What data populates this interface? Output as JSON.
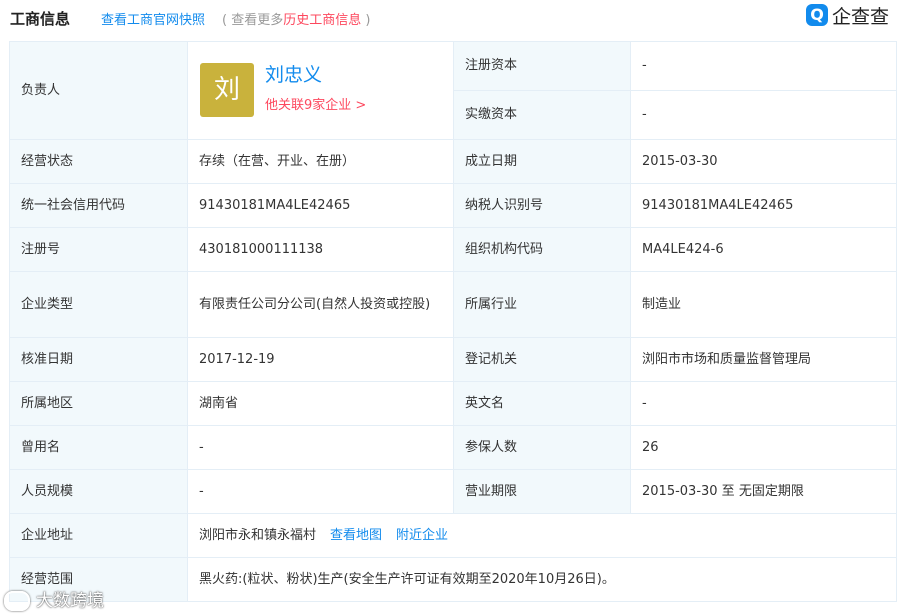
{
  "header": {
    "title": "工商信息",
    "snapshot_link": "查看工商官网快照",
    "more_prefix": "( 查看更多",
    "more_link": "历史工商信息",
    "more_suffix": " )",
    "logo_mark": "Q",
    "logo_text": "企查查"
  },
  "person": {
    "label": "负责人",
    "avatar_char": "刘",
    "name": "刘忠义",
    "related": "他关联9家企业 >"
  },
  "rows": {
    "reg_capital_label": "注册资本",
    "reg_capital_value": "-",
    "paid_capital_label": "实缴资本",
    "paid_capital_value": "-",
    "status_label": "经营状态",
    "status_value": "存续（在营、开业、在册）",
    "founded_label": "成立日期",
    "founded_value": "2015-03-30",
    "credit_code_label": "统一社会信用代码",
    "credit_code_value": "91430181MA4LE42465",
    "taxpayer_label": "纳税人识别号",
    "taxpayer_value": "91430181MA4LE42465",
    "reg_no_label": "注册号",
    "reg_no_value": "430181000111138",
    "org_code_label": "组织机构代码",
    "org_code_value": "MA4LE424-6",
    "type_label": "企业类型",
    "type_value": "有限责任公司分公司(自然人投资或控股)",
    "industry_label": "所属行业",
    "industry_value": "制造业",
    "approval_label": "核准日期",
    "approval_value": "2017-12-19",
    "authority_label": "登记机关",
    "authority_value": "浏阳市市场和质量监督管理局",
    "region_label": "所属地区",
    "region_value": "湖南省",
    "english_label": "英文名",
    "english_value": "-",
    "former_label": "曾用名",
    "former_value": "-",
    "insured_label": "参保人数",
    "insured_value": "26",
    "staff_label": "人员规模",
    "staff_value": "-",
    "term_label": "营业期限",
    "term_value": "2015-03-30 至 无固定期限",
    "address_label": "企业地址",
    "address_value": "浏阳市永和镇永福村",
    "map_link": "查看地图",
    "nearby_link": "附近企业",
    "scope_label": "经营范围",
    "scope_value": "黑火药:(粒状、粉状)生产(安全生产许可证有效期至2020年10月26日)。"
  },
  "watermark": {
    "text": "大数跨境"
  }
}
